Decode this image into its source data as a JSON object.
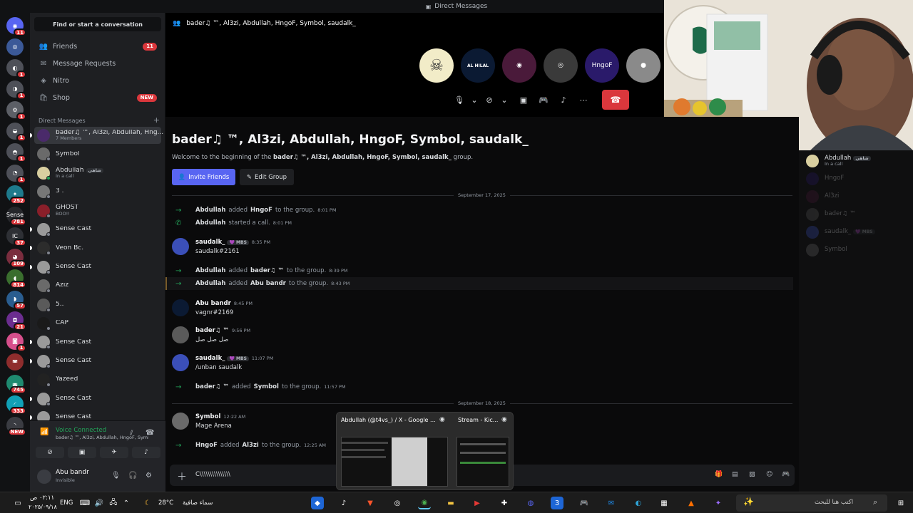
{
  "titlebar": {
    "title": "Direct Messages"
  },
  "rail": {
    "servers": [
      {
        "badge": "11",
        "color": "#5865f2",
        "label": "◉"
      },
      {
        "badge": "",
        "color": "#3b5998",
        "label": "◎"
      },
      {
        "badge": "1",
        "color": "#4e5058",
        "label": "◐"
      },
      {
        "badge": "1",
        "color": "#4e5058",
        "label": "◑"
      },
      {
        "badge": "1",
        "color": "#5c5f66",
        "label": "⚙"
      },
      {
        "badge": "1",
        "color": "#4e5058",
        "label": "◒"
      },
      {
        "badge": "1",
        "color": "#4e5058",
        "label": "◓"
      },
      {
        "badge": "1",
        "color": "#4e5058",
        "label": "◔"
      },
      {
        "badge": "252",
        "color": "#1e7a8c",
        "label": "✦"
      },
      {
        "badge": "781",
        "color": "#26272b",
        "label": "Sense"
      },
      {
        "badge": "37",
        "color": "#2e3035",
        "label": "IC"
      },
      {
        "badge": "109",
        "color": "#7a2d3e",
        "label": "◕"
      },
      {
        "badge": "814",
        "color": "#3a6e2e",
        "label": "◖"
      },
      {
        "badge": "57",
        "color": "#2a5d8f",
        "label": "◗"
      },
      {
        "badge": "21",
        "color": "#6b2d8f",
        "label": "◘"
      },
      {
        "badge": "1",
        "color": "#d64f8b",
        "label": "◙"
      },
      {
        "badge": "",
        "color": "#8f2d2d",
        "label": "◚"
      },
      {
        "badge": "745",
        "color": "#1f8a70",
        "label": "◛"
      },
      {
        "badge": "333",
        "color": "#11a0b6",
        "label": "◜"
      },
      {
        "badge": "NEW",
        "color": "#3a3c42",
        "label": "◝"
      }
    ]
  },
  "sidebar": {
    "search_label": "Find or start a conversation",
    "nav": [
      {
        "label": "Friends",
        "icon": "👥",
        "badge": "11"
      },
      {
        "label": "Message Requests",
        "icon": "✉",
        "badge": ""
      },
      {
        "label": "Nitro",
        "icon": "◈",
        "badge": ""
      },
      {
        "label": "Shop",
        "icon": "🛍",
        "badge": "NEW"
      }
    ],
    "dm_header": "Direct Messages",
    "dm_add": "+",
    "dms": [
      {
        "name": "bader♫ ™, Al3zi, Abdullah, Hng...",
        "sub": "7 Members",
        "color": "#4a2a6a",
        "status": "none",
        "active": true
      },
      {
        "name": "Symbol",
        "sub": "",
        "color": "#6a6a6a",
        "status": "off"
      },
      {
        "name": "Abdullah",
        "tag": "شاهي",
        "sub": "In a call",
        "color": "#d9cfa0",
        "status": "on"
      },
      {
        "name": "3 .",
        "sub": "",
        "color": "#777",
        "status": "off"
      },
      {
        "name": "GHOST",
        "sub": "BOO!!",
        "color": "#8a1f2a",
        "status": "off"
      },
      {
        "name": "Sense Cast",
        "sub": "",
        "color": "#9a9a9a",
        "status": "off"
      },
      {
        "name": "Veon Bc.",
        "sub": "",
        "color": "#2c2c2c",
        "status": "off"
      },
      {
        "name": "Sense Cast",
        "sub": "",
        "color": "#9a9a9a",
        "status": "off"
      },
      {
        "name": "Aziz",
        "sub": "",
        "color": "#6a6a6a",
        "status": "off"
      },
      {
        "name": "5..",
        "sub": "",
        "color": "#5a5a5a",
        "status": "off"
      },
      {
        "name": "CAP",
        "sub": "",
        "color": "#1a1a1a",
        "status": "off"
      },
      {
        "name": "Sense Cast",
        "sub": "",
        "color": "#9a9a9a",
        "status": "off"
      },
      {
        "name": "Sense Cast",
        "sub": "",
        "color": "#9a9a9a",
        "status": "off"
      },
      {
        "name": "Yazeed",
        "sub": "",
        "color": "#222",
        "status": "off"
      },
      {
        "name": "Sense Cast",
        "sub": "",
        "color": "#9a9a9a",
        "status": "off"
      },
      {
        "name": "Sense Cast",
        "sub": "",
        "color": "#9a9a9a",
        "status": "off"
      }
    ]
  },
  "voice": {
    "status": "Voice Connected",
    "channel": "bader♫ ™, Al3zi, Abdullah, HngoF, Symbol...",
    "buttons": [
      "camera-off",
      "screen-share",
      "activity",
      "soundboard"
    ]
  },
  "user": {
    "name": "Abu bandr",
    "status": "Invisible"
  },
  "call": {
    "title": "bader♫ ™, Al3zi, Abdullah, HngoF, Symbol, saudalk_",
    "tiles": [
      {
        "label": "☠",
        "color": "#f2ecc8"
      },
      {
        "label": "AL HILAL",
        "color": "#0b1a33"
      },
      {
        "label": "◉",
        "color": "#4a1a3a"
      },
      {
        "label": "◎",
        "color": "#3a3a3a"
      },
      {
        "label": "HngoF",
        "color": "#2a1a6a"
      },
      {
        "label": "●",
        "color": "#8a8a8a"
      }
    ]
  },
  "chat": {
    "title": "bader♫ ™, Al3zi, Abdullah, HngoF, Symbol, saudalk_",
    "welcome_pre": "Welcome to the beginning of the ",
    "welcome_name": "bader♫ ™, Al3zi, Abdullah, HngoF, Symbol, saudalk_",
    "welcome_post": " group.",
    "invite_label": "Invite Friends",
    "edit_label": "Edit Group",
    "date1": "September 17, 2025",
    "date2": "September 18, 2025",
    "composer_text": "C\\\\\\\\\\\\\\\\\\\\\\\\\\\\\\"
  },
  "events": [
    {
      "a": "Abdullah",
      "verb": "added",
      "b": "HngoF",
      "rest": "to the group.",
      "ts": "8:01 PM",
      "icon": "→"
    },
    {
      "a": "Abdullah",
      "verb": "started a call.",
      "b": "",
      "rest": "",
      "ts": "8:01 PM",
      "icon": "✆"
    },
    {
      "a": "Abdullah",
      "verb": "added",
      "b": "bader♫ ™",
      "rest": "to the group.",
      "ts": "8:39 PM",
      "icon": "→"
    },
    {
      "a": "Abdullah",
      "verb": "added",
      "b": "Abu bandr",
      "rest": "to the group.",
      "ts": "8:43 PM",
      "icon": "→"
    },
    {
      "a": "bader♫ ™",
      "verb": "added",
      "b": "Symbol",
      "rest": "to the group.",
      "ts": "11:57 PM",
      "icon": "→"
    },
    {
      "a": "HngoF",
      "verb": "added",
      "b": "Al3zi",
      "rest": "to the group.",
      "ts": "12:25 AM",
      "icon": "→"
    }
  ],
  "messages": [
    {
      "name": "saudalk_",
      "tag": "💜 MBS",
      "ts": "8:35 PM",
      "text": "saudalk#2161",
      "color": "#3b4fb8"
    },
    {
      "name": "Abu bandr",
      "tag": "",
      "ts": "8:45 PM",
      "text": "vagnr#2169",
      "color": "#0b1a33"
    },
    {
      "name": "bader♫ ™",
      "tag": "",
      "ts": "9:56 PM",
      "text": "صل صل صل",
      "color": "#5a5a5a"
    },
    {
      "name": "saudalk_",
      "tag": "💜 MBS",
      "ts": "11:07 PM",
      "text": "/unban saudalk",
      "color": "#3b4fb8"
    },
    {
      "name": "Symbol",
      "tag": "",
      "ts": "12:22 AM",
      "text": "Mage Arena",
      "color": "#6a6a6a"
    }
  ],
  "members": [
    {
      "name": "Abdullah",
      "tag": "شاهي",
      "sub": "In a call",
      "dim": false,
      "color": "#d9cfa0"
    },
    {
      "name": "HngoF",
      "sub": "",
      "dim": true,
      "color": "#2a1a6a"
    },
    {
      "name": "Al3zi",
      "sub": "",
      "dim": true,
      "color": "#4a1a3a"
    },
    {
      "name": "bader♫ ™",
      "sub": "",
      "dim": true,
      "color": "#5a5a5a"
    },
    {
      "name": "saudalk_",
      "tag": "💜 MBS",
      "sub": "",
      "dim": true,
      "color": "#3b4fb8"
    },
    {
      "name": "Symbol",
      "sub": "",
      "dim": true,
      "color": "#6a6a6a"
    }
  ],
  "alttab": {
    "item1": "Abdullah (@t4vs_) / X - Google ...",
    "item2": "Stream - Kic..."
  },
  "taskbar": {
    "time": "٠٢:١١ ص",
    "date": "٢٠٢٥/٠٩/١٨",
    "lang": "ENG",
    "temp": "28°C",
    "weather": "سماء صافية",
    "search": "اكتب هنا للبحث"
  }
}
